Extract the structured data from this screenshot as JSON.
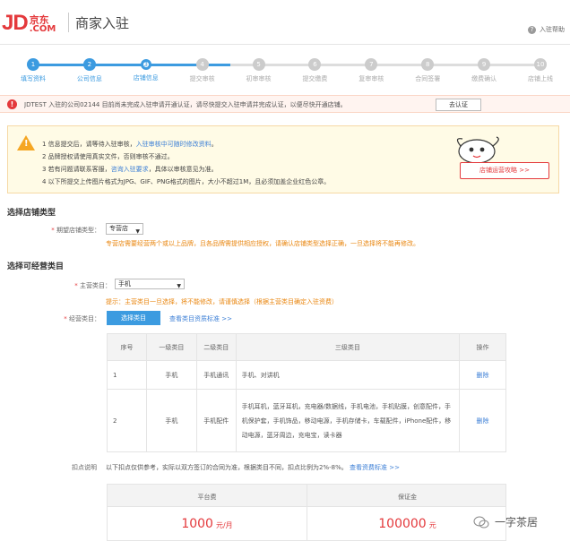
{
  "header": {
    "logo_text": "JD.COM",
    "logo_cn": "京东",
    "logo_com": ".COM",
    "logo_jd": "JD",
    "title": "商家入驻",
    "help_label": "入驻帮助"
  },
  "steps": [
    {
      "num": "1",
      "label": "填写资料",
      "state": "done"
    },
    {
      "num": "2",
      "label": "公司信息",
      "state": "done"
    },
    {
      "num": "3",
      "label": "店铺信息",
      "state": "active"
    },
    {
      "num": "4",
      "label": "提交审核",
      "state": "todo"
    },
    {
      "num": "5",
      "label": "初审审核",
      "state": "todo"
    },
    {
      "num": "6",
      "label": "提交缴费",
      "state": "todo"
    },
    {
      "num": "7",
      "label": "复审审核",
      "state": "todo"
    },
    {
      "num": "8",
      "label": "合同签署",
      "state": "todo"
    },
    {
      "num": "9",
      "label": "缴费确认",
      "state": "todo"
    },
    {
      "num": "10",
      "label": "店铺上线",
      "state": "todo"
    }
  ],
  "alert": {
    "text": "JDTEST 入驻的公司02144 目前尚未完成入驻申请开通认证，请尽快提交入驻申请并完成认证，以便尽快开通店铺。",
    "button": "去认证"
  },
  "notice": {
    "items": [
      {
        "pre": "1 信息提交后，请等待入驻审核，",
        "link": "入驻审核中可随时修改资料",
        "post": "。"
      },
      {
        "pre": "2 品牌授权请使用真实文件，否则审核不通过",
        "link": "",
        "post": "。"
      },
      {
        "pre": "3 若有问题请联系客服，",
        "link": "咨询入驻要求",
        "post": "，具体以审核意见为准。"
      },
      {
        "pre": "4 以下所提交上传图片格式为JPG、GIF、PNG格式的图片，大小不超过1M，且必须加盖企业红色公章。",
        "link": "",
        "post": ""
      }
    ],
    "promo_button": "店铺运营攻略 >>"
  },
  "shop_type": {
    "section_title": "选择店铺类型",
    "label": "期望店铺类型",
    "selected": "专营店",
    "note": "专营店需要经营两个或以上品牌，且各品牌需提供相应授权，请确认店铺类型选择正确，一旦选择将不能再修改。"
  },
  "category": {
    "section_title": "选择可经营类目",
    "main_label": "主营类目",
    "main_selected": "手机",
    "main_note": "提示：主营类目一旦选择，将不能修改，请谨慎选择（根据主营类目确定入驻资费）",
    "detail_label": "经营类目",
    "choose_button": "选择类目",
    "choose_link": "查看类目资质标准 >>",
    "table_headers": [
      "序号",
      "一级类目",
      "二级类目",
      "三级类目",
      "操作"
    ],
    "rows": [
      {
        "idx": "1",
        "l1": "手机",
        "l2": "手机通讯",
        "l3": "手机、对讲机",
        "op": "删除"
      },
      {
        "idx": "2",
        "l1": "手机",
        "l2": "手机配件",
        "l3": "手机耳机，蓝牙耳机，充电器/数据线，手机电池，手机贴膜，创意配件，手机保护套，手机饰品，移动电源，手机存储卡，车载配件，iPhone配件，移动电源，蓝牙周边，充电宝，读卡器",
        "op": "删除"
      }
    ]
  },
  "rate": {
    "label": "扣点说明",
    "text": "以下扣点仅供参考，实际以双方签订的合同为准，根据类目不同，扣点比例为2%-8%。",
    "link": "查看资费标准 >>"
  },
  "fees": {
    "deposit_label": "平台费",
    "deposit_value": "1000",
    "deposit_unit": "元/月",
    "bond_label": "保证金",
    "bond_value": "100000",
    "bond_unit": "元"
  },
  "watermark": "一字茶居"
}
